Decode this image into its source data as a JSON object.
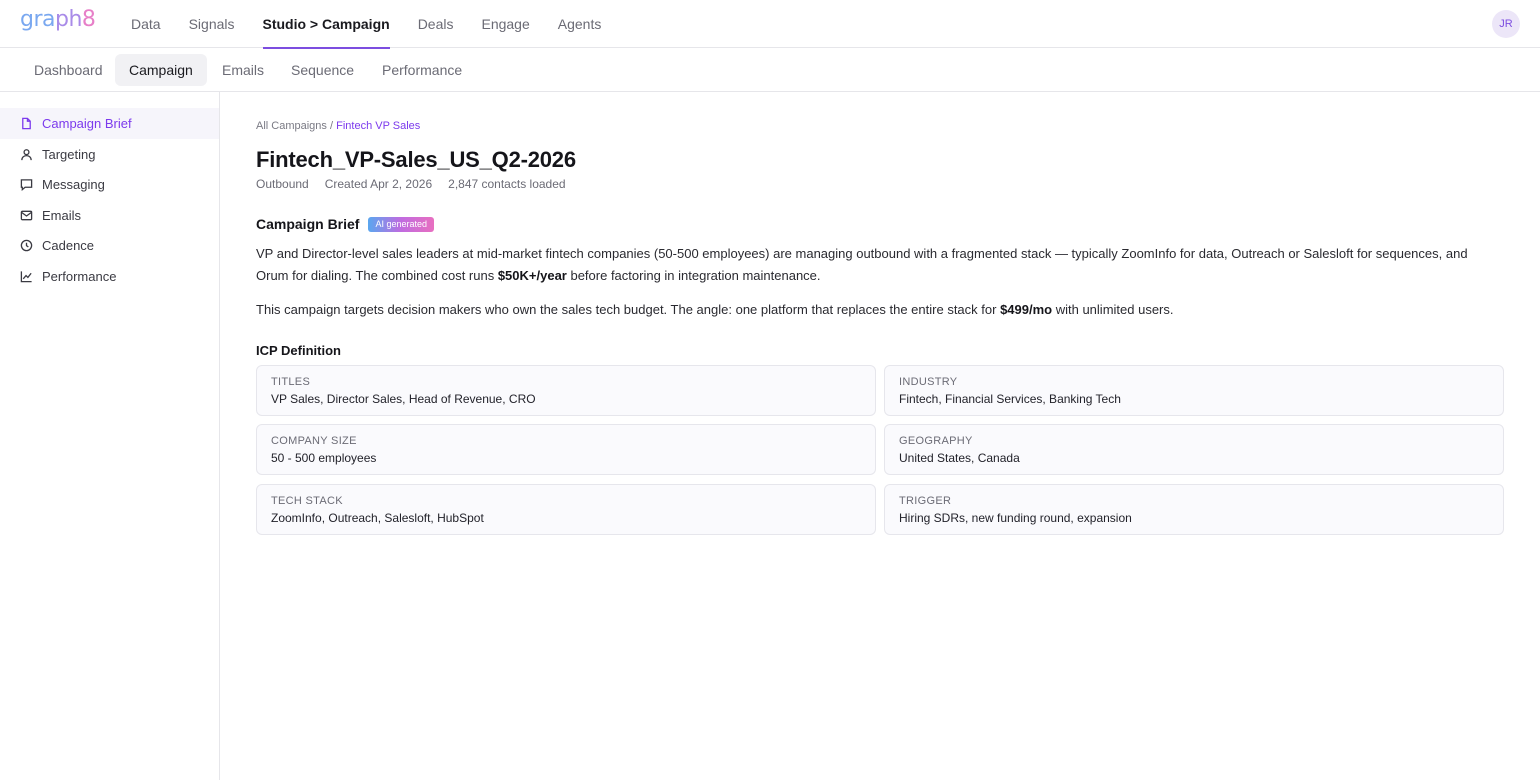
{
  "brand": {
    "logo_text": "graph8"
  },
  "user": {
    "initials": "JR"
  },
  "nav": {
    "items": [
      {
        "label": "Data"
      },
      {
        "label": "Signals"
      },
      {
        "label": "Studio > Campaign"
      },
      {
        "label": "Deals"
      },
      {
        "label": "Engage"
      },
      {
        "label": "Agents"
      }
    ],
    "active": "Studio > Campaign"
  },
  "subtabs": {
    "items": [
      {
        "label": "Dashboard"
      },
      {
        "label": "Campaign"
      },
      {
        "label": "Emails"
      },
      {
        "label": "Sequence"
      },
      {
        "label": "Performance"
      }
    ],
    "active": "Campaign"
  },
  "sidebar": {
    "items": [
      {
        "label": "Campaign Brief",
        "icon": "document-icon"
      },
      {
        "label": "Targeting",
        "icon": "person-icon"
      },
      {
        "label": "Messaging",
        "icon": "chat-icon"
      },
      {
        "label": "Emails",
        "icon": "mail-icon"
      },
      {
        "label": "Cadence",
        "icon": "clock-icon"
      },
      {
        "label": "Performance",
        "icon": "chart-icon"
      }
    ],
    "active": "Campaign Brief"
  },
  "breadcrumb": {
    "root": "All Campaigns",
    "separator": "/",
    "current": "Fintech VP Sales"
  },
  "campaign": {
    "title": "Fintech_VP-Sales_US_Q2-2026",
    "type": "Outbound",
    "created": "Created Apr 2, 2026",
    "contacts": "2,847 contacts loaded"
  },
  "brief": {
    "heading": "Campaign Brief",
    "badge": "AI generated",
    "p1_a": "VP and Director-level sales leaders at mid-market fintech companies (50-500 employees) are managing outbound with a fragmented stack — typically ZoomInfo for data, Outreach or Salesloft for sequences, and Orum for dialing. The combined cost runs ",
    "p1_bold": "$50K+/year",
    "p1_b": " before factoring in integration maintenance.",
    "p2_a": "This campaign targets decision makers who own the sales tech budget. The angle: one platform that replaces the entire stack for ",
    "p2_bold": "$499/mo",
    "p2_b": " with unlimited users."
  },
  "icp": {
    "heading": "ICP Definition",
    "cards": [
      {
        "label": "Titles",
        "value": "VP Sales, Director Sales, Head of Revenue, CRO"
      },
      {
        "label": "Industry",
        "value": "Fintech, Financial Services, Banking Tech"
      },
      {
        "label": "Company Size",
        "value": "50 - 500 employees"
      },
      {
        "label": "Geography",
        "value": "United States, Canada"
      },
      {
        "label": "Tech Stack",
        "value": "ZoomInfo, Outreach, Salesloft, HubSpot"
      },
      {
        "label": "Trigger",
        "value": "Hiring SDRs, new funding round, expansion"
      }
    ]
  },
  "colors": {
    "accent": "#7c3aed",
    "border": "#e6e6ea"
  }
}
